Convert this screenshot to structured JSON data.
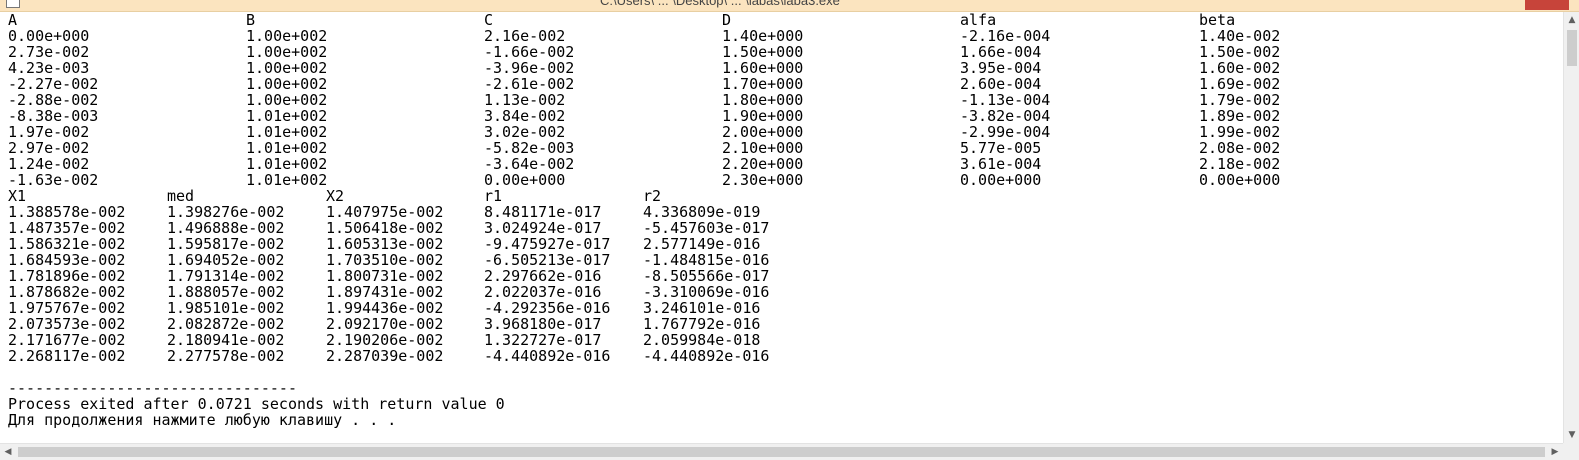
{
  "window": {
    "title": "C:\\Users\\ ... \\Desktop\\ ... \\labas\\laba3.exe"
  },
  "table1": {
    "headers": [
      "A",
      "B",
      "C",
      "D",
      "alfa",
      "beta"
    ],
    "rows": [
      [
        "0.00e+000",
        "1.00e+002",
        "2.16e-002",
        "1.40e+000",
        "-2.16e-004",
        "1.40e-002"
      ],
      [
        "2.73e-002",
        "1.00e+002",
        "-1.66e-002",
        "1.50e+000",
        "1.66e-004",
        "1.50e-002"
      ],
      [
        "4.23e-003",
        "1.00e+002",
        "-3.96e-002",
        "1.60e+000",
        "3.95e-004",
        "1.60e-002"
      ],
      [
        "-2.27e-002",
        "1.00e+002",
        "-2.61e-002",
        "1.70e+000",
        "2.60e-004",
        "1.69e-002"
      ],
      [
        "-2.88e-002",
        "1.00e+002",
        "1.13e-002",
        "1.80e+000",
        "-1.13e-004",
        "1.79e-002"
      ],
      [
        "-8.38e-003",
        "1.01e+002",
        "3.84e-002",
        "1.90e+000",
        "-3.82e-004",
        "1.89e-002"
      ],
      [
        "1.97e-002",
        "1.01e+002",
        "3.02e-002",
        "2.00e+000",
        "-2.99e-004",
        "1.99e-002"
      ],
      [
        "2.97e-002",
        "1.01e+002",
        "-5.82e-003",
        "2.10e+000",
        "5.77e-005",
        "2.08e-002"
      ],
      [
        "1.24e-002",
        "1.01e+002",
        "-3.64e-002",
        "2.20e+000",
        "3.61e-004",
        "2.18e-002"
      ],
      [
        "-1.63e-002",
        "1.01e+002",
        "0.00e+000",
        "2.30e+000",
        "0.00e+000",
        "0.00e+000"
      ]
    ]
  },
  "table2": {
    "headers": [
      "X1",
      "med",
      "X2",
      "r1",
      "r2"
    ],
    "rows": [
      [
        "1.388578e-002",
        "1.398276e-002",
        "1.407975e-002",
        "8.481171e-017",
        "4.336809e-019"
      ],
      [
        "1.487357e-002",
        "1.496888e-002",
        "1.506418e-002",
        "3.024924e-017",
        "-5.457603e-017"
      ],
      [
        "1.586321e-002",
        "1.595817e-002",
        "1.605313e-002",
        "-9.475927e-017",
        "2.577149e-016"
      ],
      [
        "1.684593e-002",
        "1.694052e-002",
        "1.703510e-002",
        "-6.505213e-017",
        "-1.484815e-016"
      ],
      [
        "1.781896e-002",
        "1.791314e-002",
        "1.800731e-002",
        "2.297662e-016",
        "-8.505566e-017"
      ],
      [
        "1.878682e-002",
        "1.888057e-002",
        "1.897431e-002",
        "2.022037e-016",
        "-3.310069e-016"
      ],
      [
        "1.975767e-002",
        "1.985101e-002",
        "1.994436e-002",
        "-4.292356e-016",
        "3.246101e-016"
      ],
      [
        "2.073573e-002",
        "2.082872e-002",
        "2.092170e-002",
        "3.968180e-017",
        "1.767792e-016"
      ],
      [
        "2.171677e-002",
        "2.180941e-002",
        "2.190206e-002",
        "1.322727e-017",
        "2.059984e-018"
      ],
      [
        "2.268117e-002",
        "2.277578e-002",
        "2.287039e-002",
        "-4.440892e-016",
        "-4.440892e-016"
      ]
    ]
  },
  "footer": {
    "separator": "--------------------------------",
    "process_line": "Process exited after 0.0721 seconds with return value 0",
    "prompt_line": "Для продолжения нажмите любую клавишу . . ."
  },
  "icons": {
    "scroll_up": "scroll-up-arrow-icon",
    "scroll_down": "scroll-down-arrow-icon",
    "scroll_left": "scroll-left-arrow-icon",
    "scroll_right": "scroll-right-arrow-icon"
  },
  "colors": {
    "console_bg": "#ffffff",
    "console_fg": "#000000",
    "titlebar_bg": "#fbe4bf",
    "close_button": "#c7443a",
    "scrollbar_track": "#f0f0f0",
    "scrollbar_thumb": "#cdcdcd"
  }
}
